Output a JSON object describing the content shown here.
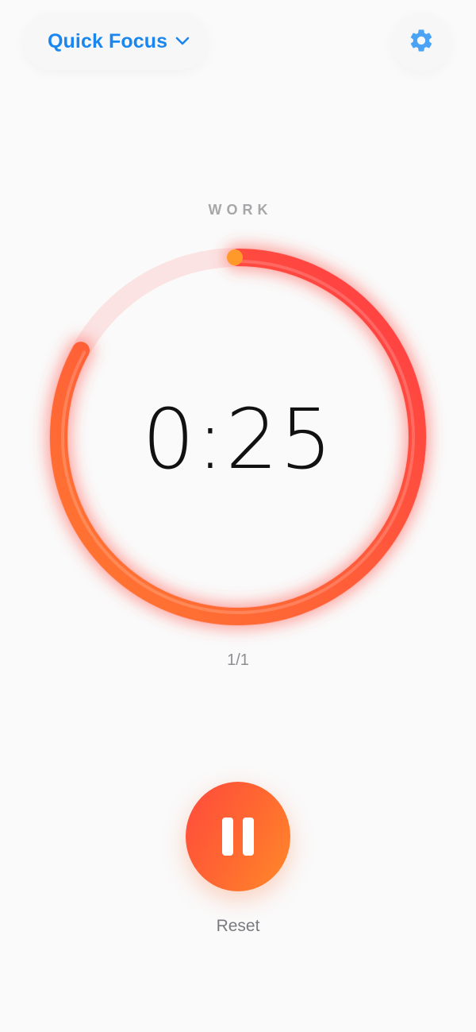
{
  "header": {
    "preset_label": "Quick Focus",
    "preset_icon": "chevron-down-icon",
    "settings_icon": "gear-icon"
  },
  "timer": {
    "phase_label": "WORK",
    "time": "0:25",
    "round": "1/1",
    "progress_remaining": 0.83
  },
  "controls": {
    "pause_icon": "pause-icon",
    "reset_label": "Reset"
  },
  "colors": {
    "accent": "#1a86f0",
    "ring_start": "#ff3b45",
    "ring_end": "#ff7a2e",
    "ring_track": "#fbe0e0",
    "text_muted": "#a7a7aa"
  }
}
